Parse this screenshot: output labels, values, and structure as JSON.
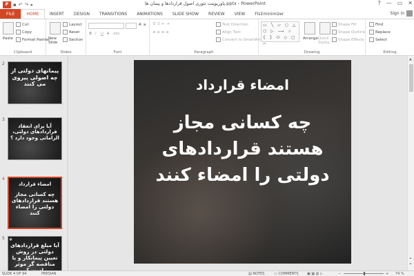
{
  "titlebar": {
    "app_logo": "P",
    "title": "پاورپوینت تئوری اصول قراردادها و پیمان ها.pptx - PowerPoint",
    "help": "?",
    "minimize": "—",
    "restore": "▭",
    "close": "✕"
  },
  "tabs": [
    {
      "label": "FILE"
    },
    {
      "label": "HOME"
    },
    {
      "label": "INSERT"
    },
    {
      "label": "DESIGN"
    },
    {
      "label": "TRANSITIONS"
    },
    {
      "label": "ANIMATIONS"
    },
    {
      "label": "SLIDE SHOW"
    },
    {
      "label": "REVIEW"
    },
    {
      "label": "VIEW"
    },
    {
      "label": "FILEminimizer"
    }
  ],
  "account": {
    "signin": "Sign in"
  },
  "ribbon": {
    "clipboard": {
      "paste": "Paste",
      "cut": "Cut",
      "copy": "Copy",
      "format_painter": "Format Painter",
      "label": "Clipboard"
    },
    "slides": {
      "new_slide": "New Slide",
      "layout": "Layout",
      "reset": "Reset",
      "section": "Section",
      "label": "Slides"
    },
    "font": {
      "label": "Font",
      "bold": "B",
      "italic": "I",
      "underline": "U",
      "strike": "S",
      "abc": "abc"
    },
    "paragraph": {
      "text_direction": "Text Direction",
      "align_text": "Align Text",
      "convert": "Convert to SmartArt",
      "label": "Paragraph"
    },
    "drawing": {
      "shapes": "▭ ╲ ▱ ○ △ ⬡ ▷ ⟶ ☆ { } ⬭ ◇ ▢ ⌒",
      "arrange": "Arrange",
      "quick_styles": "Quick Styles",
      "shape_fill": "Shape Fill",
      "shape_outline": "Shape Outline",
      "shape_effects": "Shape Effects",
      "label": "Drawing"
    },
    "editing": {
      "find": "Find",
      "replace": "Replace",
      "select": "Select",
      "label": "Editing"
    }
  },
  "thumbnails": [
    {
      "num": "2",
      "text": "پیمانهای دولتی از چه اصولی پیروی می کنند"
    },
    {
      "num": "3",
      "text": "آیا برای انعقاد قراردادهای دولتی، الزاماتی وجود دارد ؟"
    },
    {
      "num": "4",
      "title": "امضاء قرارداد",
      "text": "چه کسانی مجاز هستند قراردادهای دولتی را امضاء کنند"
    },
    {
      "num": "5",
      "text": "آیا مبلغ قراردادهای دولتی در روش تعیین پیمانکار و یا مناقصه گر موثر است ؟"
    }
  ],
  "slide": {
    "title": "امضاء قرارداد",
    "body": "چه کسانی مجاز هستند قراردادهای دولتی را امضاء کنند"
  },
  "statusbar": {
    "slide_info": "SLIDE 4 OF 94",
    "language": "PERSIAN",
    "notes": "NOTES",
    "comments": "COMMENTS",
    "zoom": "74 %"
  }
}
